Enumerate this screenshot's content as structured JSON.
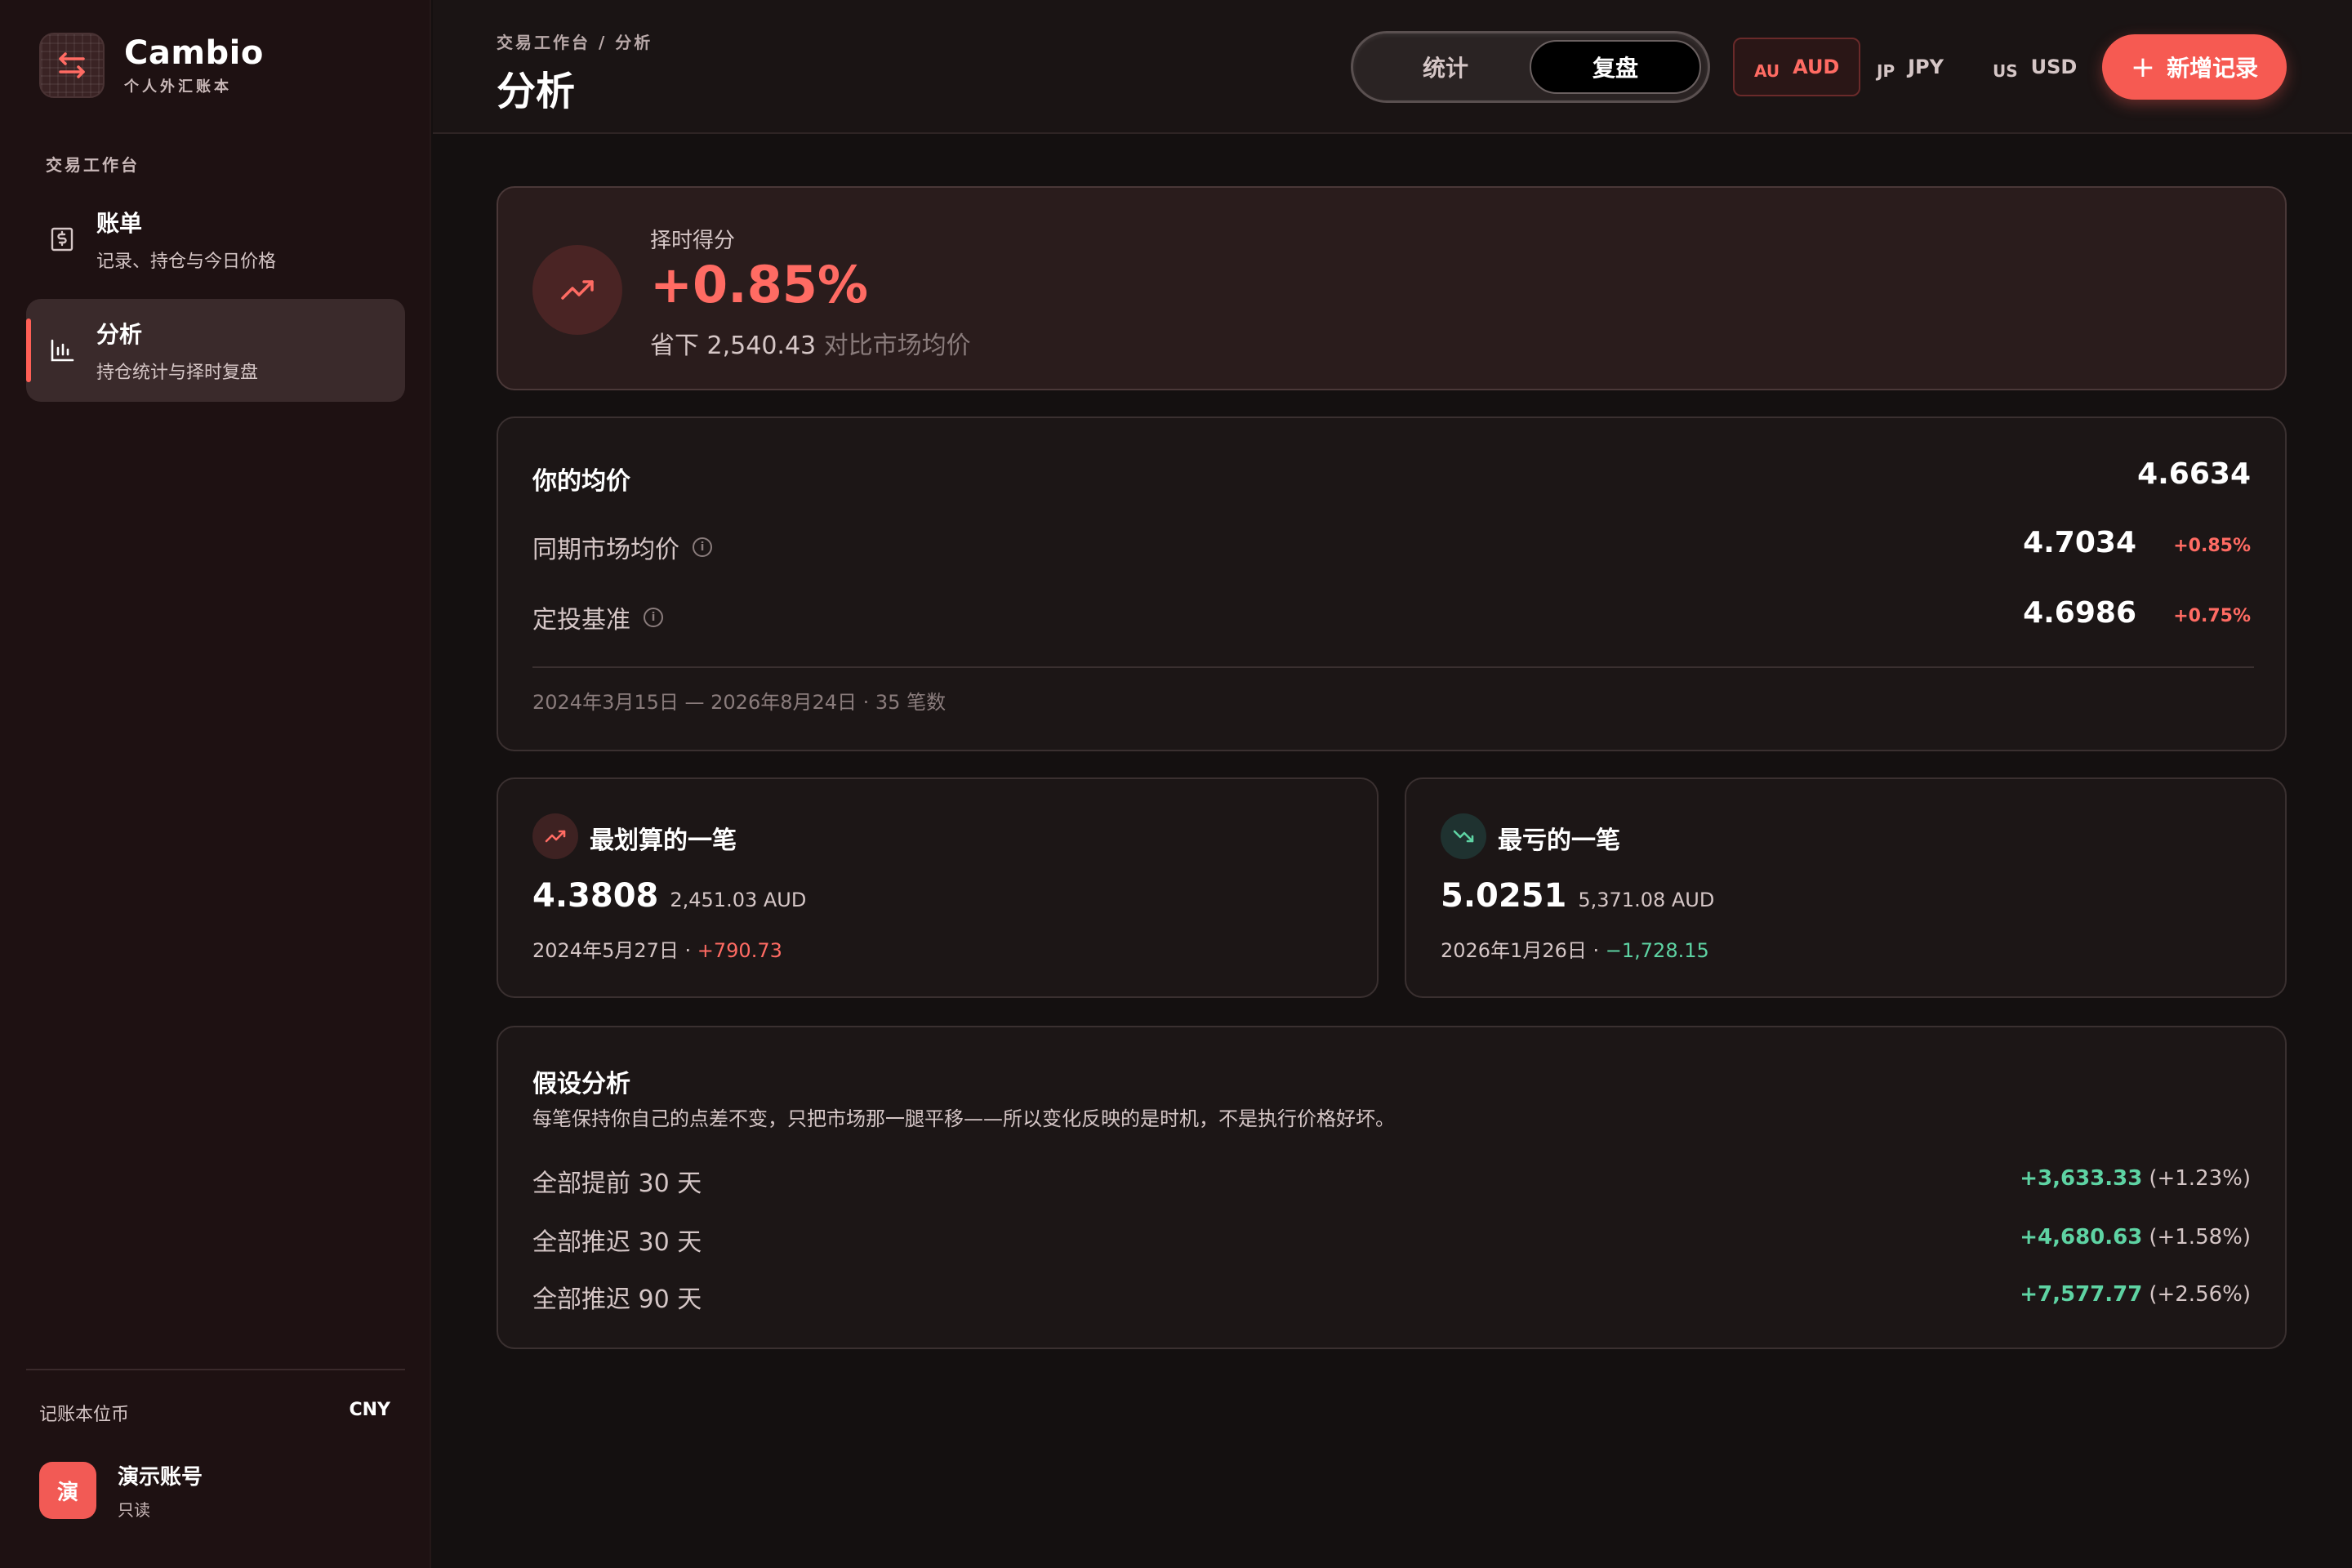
{
  "brand": {
    "name": "Cambio",
    "subtitle": "个人外汇账本"
  },
  "sidebar": {
    "section": "交易工作台",
    "items": [
      {
        "title": "账单",
        "subtitle": "记录、持仓与今日价格",
        "icon": "receipt-icon",
        "active": false
      },
      {
        "title": "分析",
        "subtitle": "持仓统计与择时复盘",
        "icon": "bar-chart-icon",
        "active": true
      }
    ],
    "base_currency_label": "记账本位币",
    "base_currency_value": "CNY",
    "account": {
      "avatar": "演",
      "name": "演示账号",
      "role": "只读"
    }
  },
  "header": {
    "breadcrumb": "交易工作台  /  分析",
    "title": "分析",
    "tabs": [
      {
        "label": "统计",
        "active": false
      },
      {
        "label": "复盘",
        "active": true
      }
    ],
    "currencies": [
      {
        "code": "AU",
        "label": "AUD",
        "active": true
      },
      {
        "code": "JP",
        "label": "JPY",
        "active": false
      },
      {
        "code": "US",
        "label": "USD",
        "active": false
      }
    ],
    "add_label": "新增记录"
  },
  "score": {
    "label": "择时得分",
    "value": "+0.85%",
    "saved_text": "省下 2,540.43",
    "saved_suffix": " 对比市场均价"
  },
  "average": {
    "title": "你的均价",
    "your_value": "4.6634",
    "rows": [
      {
        "label": "同期市场均价",
        "value": "4.7034",
        "pct": "+0.85%"
      },
      {
        "label": "定投基准",
        "value": "4.6986",
        "pct": "+0.75%"
      }
    ],
    "range": "2024年3月15日 — 2026年8月24日 · 35 笔数"
  },
  "best": {
    "title": "最划算的一笔",
    "rate": "4.3808",
    "amount": "2,451.03 AUD",
    "date": "2024年5月27日 · ",
    "delta": "+790.73"
  },
  "worst": {
    "title": "最亏的一笔",
    "rate": "5.0251",
    "amount": "5,371.08 AUD",
    "date": "2026年1月26日 · ",
    "delta": "−1,728.15"
  },
  "whatif": {
    "title": "假设分析",
    "desc": "每笔保持你自己的点差不变，只把市场那一腿平移——所以变化反映的是时机，不是执行价格好坏。",
    "rows": [
      {
        "label": "全部提前 30 天",
        "value": "+3,633.33",
        "pct": "(+1.23%)"
      },
      {
        "label": "全部推迟 30 天",
        "value": "+4,680.63",
        "pct": "(+1.58%)"
      },
      {
        "label": "全部推迟 90 天",
        "value": "+7,577.77",
        "pct": "(+2.56%)"
      }
    ]
  },
  "colors": {
    "accent": "#f65a52",
    "positive_red": "#ff6b63",
    "positive_green": "#5ed3a3",
    "bg": "#141010",
    "sidebar": "#1e1112"
  }
}
